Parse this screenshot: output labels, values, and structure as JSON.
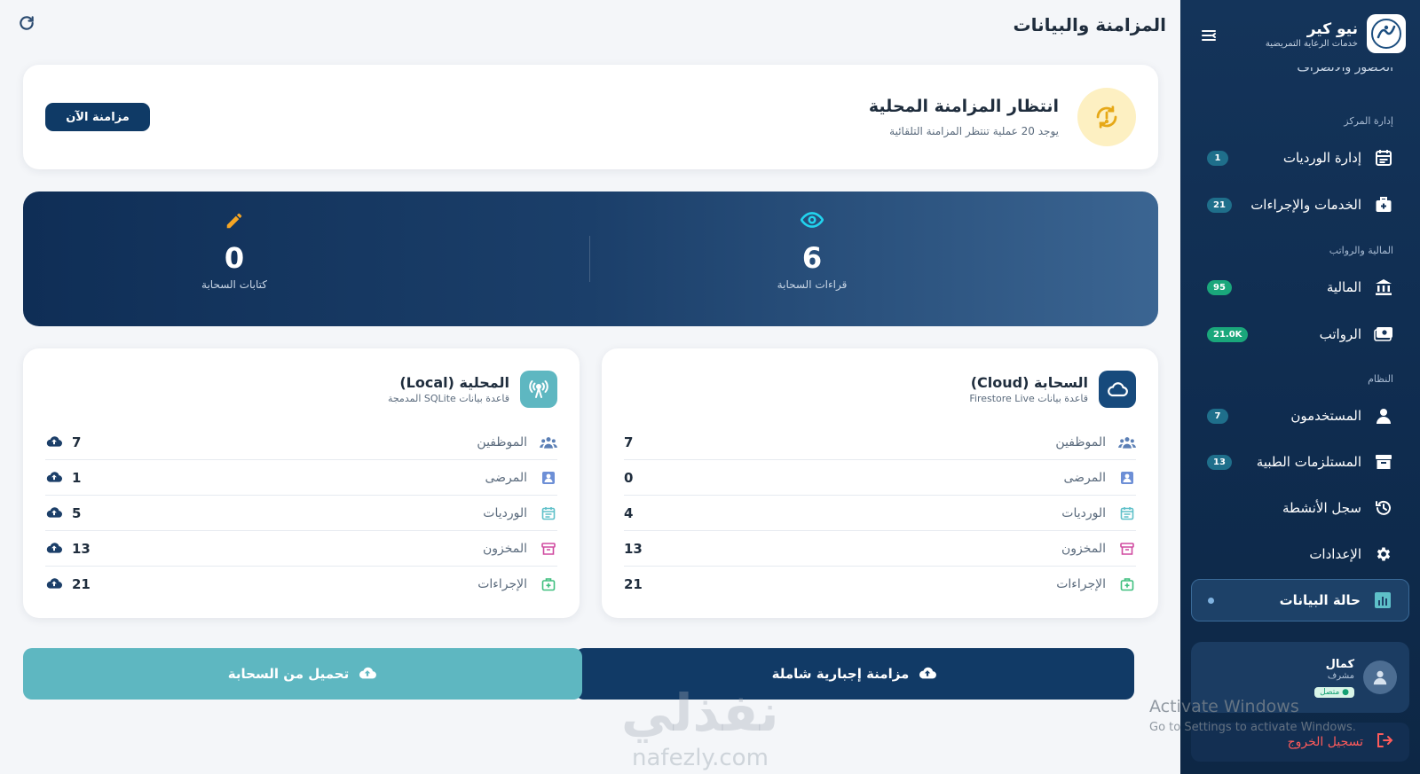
{
  "sidebar": {
    "brand_name": "نيو كير",
    "brand_sub": "خدمات الرعاية التمريضية",
    "cut_item": "الحضور والانصراف",
    "sections": {
      "center": "إدارة المركز",
      "finance": "المالية والرواتب",
      "system": "النظام"
    },
    "items": [
      {
        "label": "إدارة الورديات",
        "badge": "1",
        "icon": "calendar-icon"
      },
      {
        "label": "الخدمات والإجراءات",
        "badge": "21",
        "icon": "medical-kit-icon"
      },
      {
        "label": "المالية",
        "badge": "95",
        "icon": "bank-icon"
      },
      {
        "label": "الرواتب",
        "badge": "21.0K",
        "icon": "money-icon"
      },
      {
        "label": "المستخدمون",
        "badge": "7",
        "icon": "user-icon"
      },
      {
        "label": "المستلزمات الطبية",
        "badge": "13",
        "icon": "archive-icon"
      },
      {
        "label": "سجل الأنشطة",
        "badge": "",
        "icon": "history-icon"
      },
      {
        "label": "الإعدادات",
        "badge": "",
        "icon": "gear-icon"
      },
      {
        "label": "حالة البيانات",
        "badge": "",
        "icon": "chart-icon"
      }
    ],
    "user": {
      "name": "كمال",
      "role": "مشرف",
      "status": "متصل"
    },
    "logout": "تسجيل الخروج"
  },
  "main": {
    "title": "المزامنة والبيانات",
    "pending": {
      "title": "انتظار المزامنة المحلية",
      "subtitle": "يوجد 20 عملية تنتظر المزامنة التلقائية",
      "button": "مزامنة الآن"
    },
    "stats": {
      "reads_value": "6",
      "reads_label": "قراءات السحابة",
      "writes_value": "0",
      "writes_label": "كتابات السحابة"
    },
    "cloud": {
      "title": "السحابة (Cloud)",
      "subtitle": "قاعدة بيانات Firestore Live",
      "rows": [
        {
          "label": "الموظفين",
          "value": "7"
        },
        {
          "label": "المرضى",
          "value": "0"
        },
        {
          "label": "الورديات",
          "value": "4"
        },
        {
          "label": "المخزون",
          "value": "13"
        },
        {
          "label": "الإجراءات",
          "value": "21"
        }
      ]
    },
    "local": {
      "title": "المحلية (Local)",
      "subtitle": "قاعدة بيانات SQLite المدمجة",
      "rows": [
        {
          "label": "الموظفين",
          "value": "7"
        },
        {
          "label": "المرضى",
          "value": "1"
        },
        {
          "label": "الورديات",
          "value": "5"
        },
        {
          "label": "المخزون",
          "value": "13"
        },
        {
          "label": "الإجراءات",
          "value": "21"
        }
      ]
    },
    "force_sync": "مزامنة إجبارية شاملة",
    "download": "تحميل من السحابة"
  },
  "overlay": {
    "watermark": "نفذلي",
    "watermark_url": "nafezly.com",
    "activate_title": "Activate Windows",
    "activate_sub": "Go to Settings to activate Windows."
  }
}
